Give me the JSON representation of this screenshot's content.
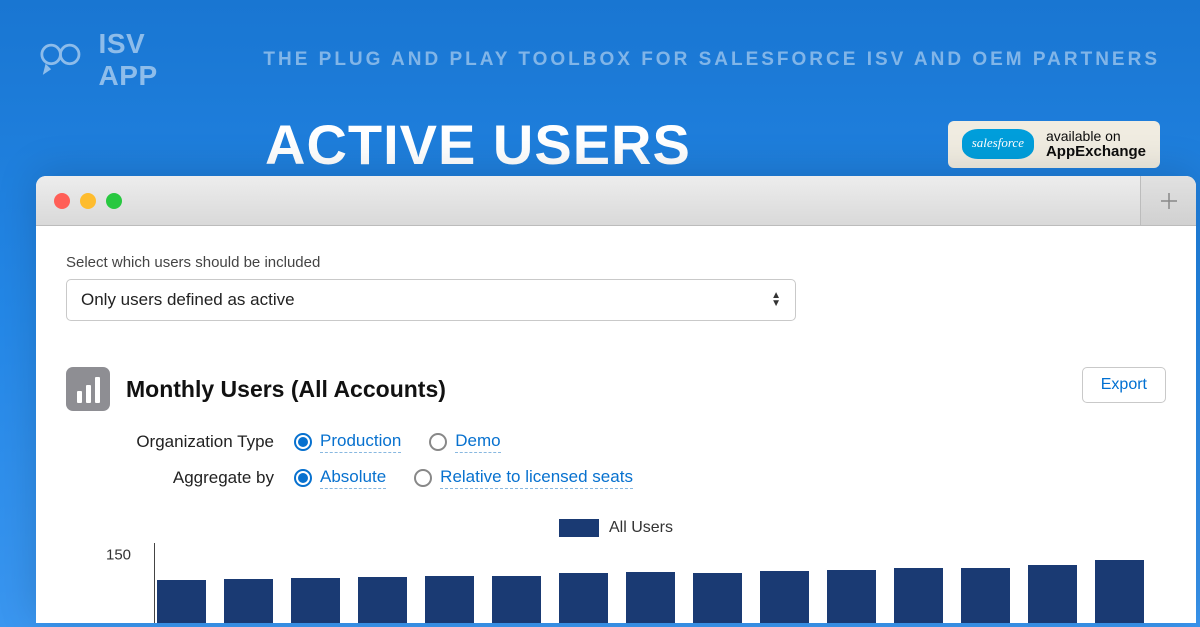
{
  "header": {
    "logo_text": "ISV APP",
    "tagline": "THE PLUG AND PLAY TOOLBOX FOR SALESFORCE ISV AND OEM PARTNERS"
  },
  "title": "ACTIVE USERS",
  "appexchange": {
    "cloud": "salesforce",
    "line1": "available on",
    "line2": "AppExchange"
  },
  "window": {
    "new_tab_name": "new-tab"
  },
  "form": {
    "select_label": "Select which users should be included",
    "select_value": "Only users defined as active"
  },
  "chart": {
    "title": "Monthly Users (All Accounts)",
    "export_label": "Export",
    "org_type_label": "Organization Type",
    "org_type_options": {
      "production": "Production",
      "demo": "Demo"
    },
    "aggregate_label": "Aggregate by",
    "aggregate_options": {
      "absolute": "Absolute",
      "relative": "Relative to licensed seats"
    },
    "legend_label": "All Users"
  },
  "chart_data": {
    "type": "bar",
    "title": "Monthly Users (All Accounts)",
    "ylabel": "",
    "xlabel": "",
    "ylim": [
      0,
      160
    ],
    "yticks": [
      150
    ],
    "series": [
      {
        "name": "All Users",
        "values": [
          95,
          96,
          99,
          102,
          104,
          104,
          111,
          112,
          110,
          115,
          117,
          122,
          121,
          128,
          140
        ]
      }
    ],
    "colors": {
      "all_users": "#1a3a73"
    }
  }
}
